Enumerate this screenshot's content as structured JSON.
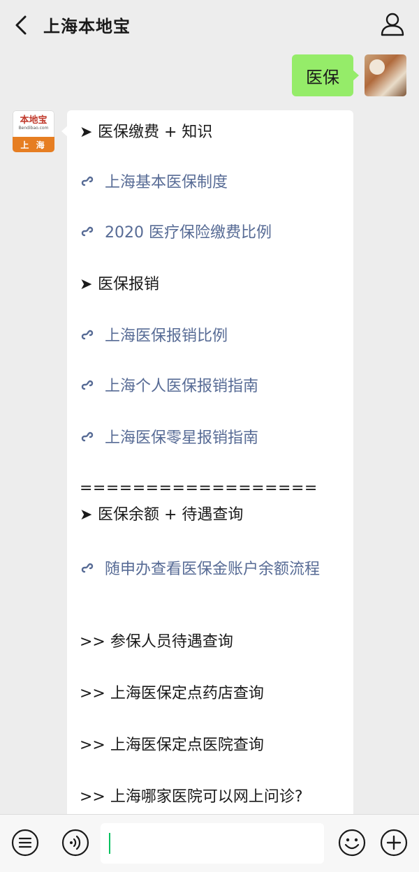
{
  "header": {
    "title": "上海本地宝",
    "back_icon": "chevron-left-icon",
    "profile_icon": "person-icon"
  },
  "my_message": {
    "text": "医保"
  },
  "bot": {
    "avatar": {
      "logo_text": "本地宝",
      "logo_sub": "Bendibao.com",
      "city": "上 海"
    },
    "lines": [
      {
        "kind": "heading",
        "text": "医保缴费 + 知识"
      },
      {
        "kind": "link",
        "text": "上海基本医保制度"
      },
      {
        "kind": "link",
        "text": "2020 医疗保险缴费比例"
      },
      {
        "kind": "heading",
        "text": "医保报销"
      },
      {
        "kind": "link",
        "text": "上海医保报销比例"
      },
      {
        "kind": "link",
        "text": "上海个人医保报销指南"
      },
      {
        "kind": "link",
        "text": "上海医保零星报销指南"
      },
      {
        "kind": "separator",
        "text": "=================="
      },
      {
        "kind": "heading",
        "text": "医保余额 + 待遇查询"
      },
      {
        "kind": "link",
        "text": "随申办查看医保金账户余额流程"
      },
      {
        "kind": "plain",
        "text": ">> 参保人员待遇查询"
      },
      {
        "kind": "plain",
        "text": ">> 上海医保定点药店查询"
      },
      {
        "kind": "plain",
        "text": ">> 上海医保定点医院查询"
      },
      {
        "kind": "plain",
        "text": ">> 上海哪家医院可以网上问诊?"
      }
    ],
    "heading_marker": "➤",
    "link_icon": "mini-program-icon"
  },
  "input_bar": {
    "menu_icon": "list-menu-icon",
    "voice_icon": "voice-icon",
    "emoji_icon": "emoji-icon",
    "plus_icon": "plus-icon",
    "input_value": ""
  },
  "colors": {
    "background": "#ededed",
    "my_bubble": "#95ec69",
    "link": "#576b95",
    "caret": "#07c160"
  }
}
